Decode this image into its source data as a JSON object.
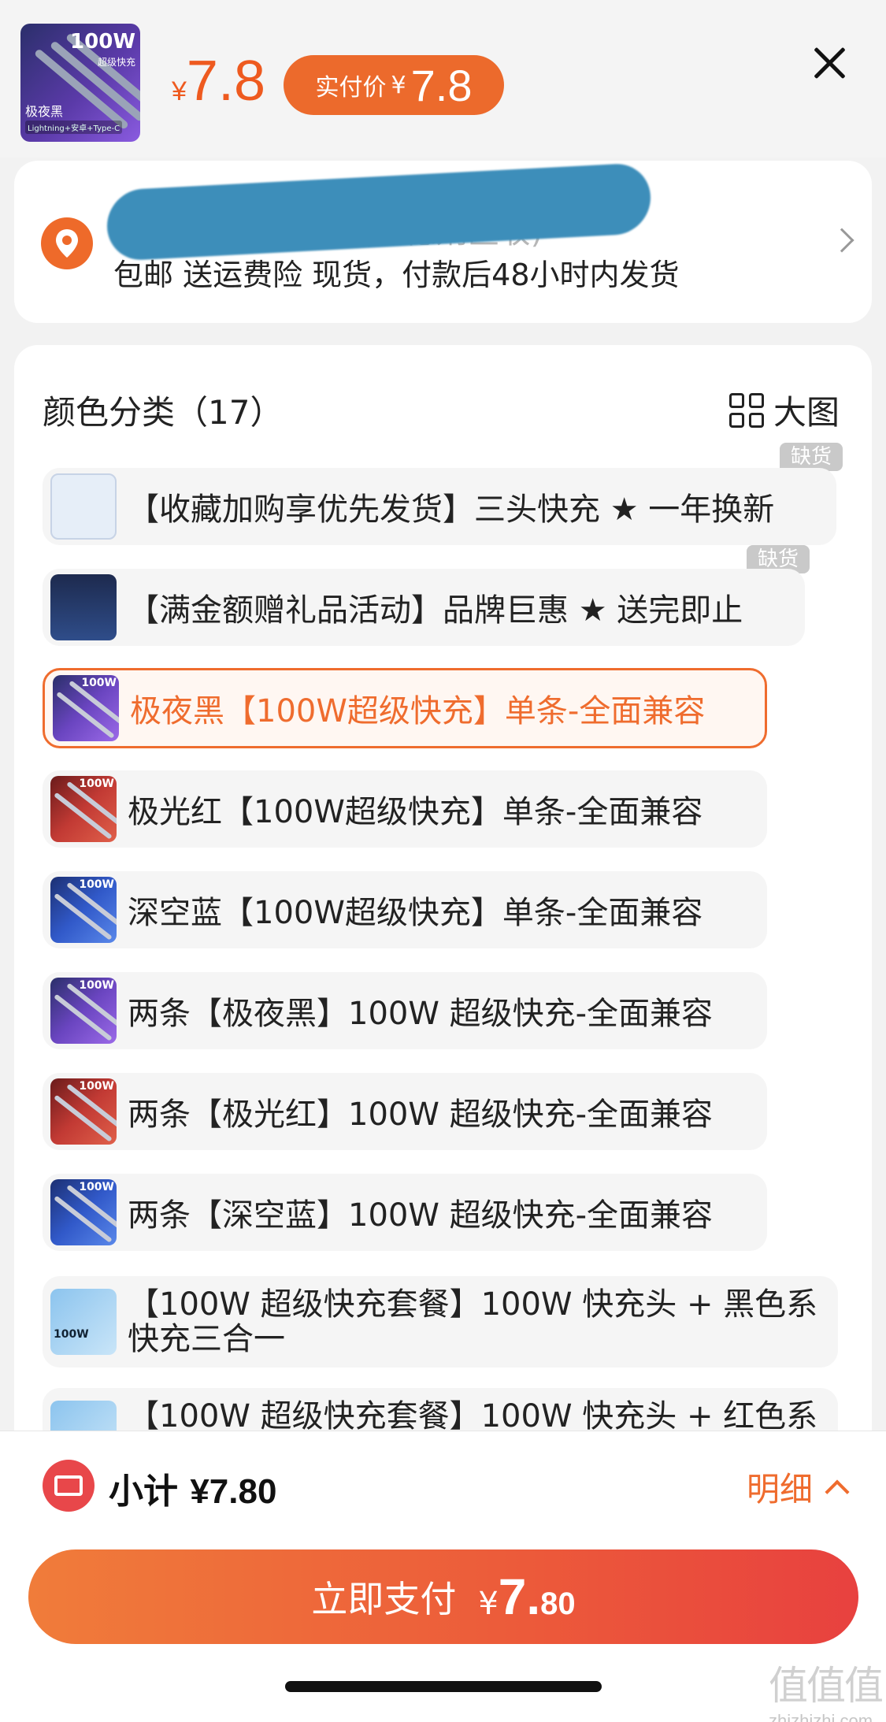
{
  "header": {
    "product_thumb": {
      "badge": "100W",
      "badge_sub": "超级快充",
      "tag": "极夜黑",
      "tag_sub": "Lightning+安卓+Type-C"
    },
    "price_yen": "¥",
    "price_value": "7.8",
    "pay_pill_label": "实付价",
    "pay_pill_yen": "¥",
    "pay_pill_value": "7.8",
    "close_icon": "close-icon"
  },
  "address": {
    "name_redacted": "(实德剂区收)",
    "shipping_info": "包邮  送运费险  现货，付款后48小时内发货"
  },
  "spec": {
    "title": "颜色分类（17）",
    "big_image_label": "大图",
    "options": [
      {
        "label": "【收藏加购享优先发货】三头快充 ★ 一年换新",
        "badge": "缺货"
      },
      {
        "label": "【满金额赠礼品活动】品牌巨惠 ★ 送完即止",
        "badge": "缺货"
      },
      {
        "label": "极夜黑【100W超级快充】单条-全面兼容",
        "selected": true
      },
      {
        "label": "极光红【100W超级快充】单条-全面兼容"
      },
      {
        "label": "深空蓝【100W超级快充】单条-全面兼容"
      },
      {
        "label": "两条【极夜黑】100W 超级快充-全面兼容"
      },
      {
        "label": "两条【极光红】100W 超级快充-全面兼容"
      },
      {
        "label": "两条【深空蓝】100W 超级快充-全面兼容"
      },
      {
        "label": "【100W 超级快充套餐】100W 快充头 + 黑色系快充三合一"
      },
      {
        "label": "【100W 超级快充套餐】100W 快充头 + 红色系"
      }
    ]
  },
  "footer": {
    "subtotal_label": "小计",
    "subtotal_value": "¥7.80",
    "detail_label": "明细",
    "pay_label": "立即支付",
    "pay_yen": "¥",
    "pay_int": "7.",
    "pay_dec": "80"
  },
  "watermark": {
    "big": "值值值",
    "small": "zhizhizhi.com"
  },
  "colors": {
    "accent": "#ef6c2e",
    "pay_gradient_start": "#f07c3a",
    "pay_gradient_end": "#e8413f",
    "redaction": "#3d8eba"
  }
}
